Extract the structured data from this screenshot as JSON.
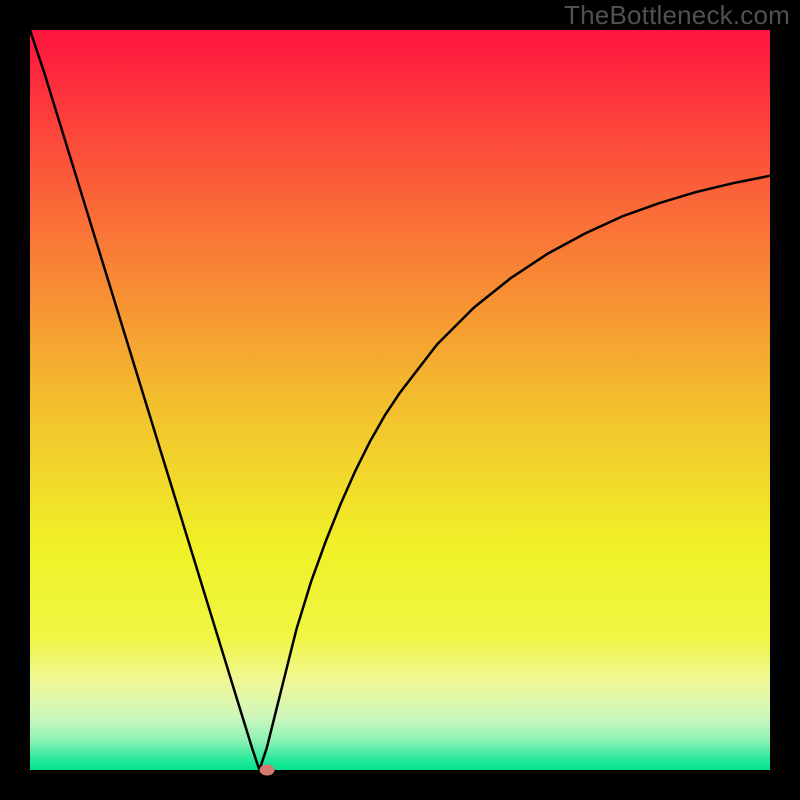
{
  "watermark": "TheBottleneck.com",
  "chart_data": {
    "type": "line",
    "title": "",
    "xlabel": "",
    "ylabel": "",
    "xlim": [
      0,
      100
    ],
    "ylim": [
      0,
      100
    ],
    "x": [
      0,
      2,
      4,
      6,
      8,
      10,
      12,
      14,
      16,
      18,
      20,
      22,
      24,
      26,
      28,
      30,
      31,
      32,
      33,
      34,
      35,
      36,
      38,
      40,
      42,
      44,
      46,
      48,
      50,
      55,
      60,
      65,
      70,
      75,
      80,
      85,
      90,
      95,
      100
    ],
    "y": [
      100,
      94,
      87.5,
      81,
      74.5,
      68,
      61.5,
      55,
      48.5,
      42,
      35.5,
      29,
      22.5,
      16,
      9.5,
      3,
      0,
      3,
      7,
      11,
      15,
      19,
      25.5,
      31,
      36,
      40.5,
      44.5,
      48,
      51,
      57.5,
      62.5,
      66.5,
      69.8,
      72.5,
      74.8,
      76.6,
      78.1,
      79.3,
      80.3
    ],
    "marker": {
      "x": 32,
      "y": 0
    },
    "gradient_stops": [
      {
        "offset": 0,
        "color": "#fe143e"
      },
      {
        "offset": 0.25,
        "color": "#fa6d38"
      },
      {
        "offset": 0.5,
        "color": "#f3bd2e"
      },
      {
        "offset": 0.7,
        "color": "#f0f128"
      },
      {
        "offset": 0.82,
        "color": "#f0f643"
      },
      {
        "offset": 0.88,
        "color": "#f1f796"
      },
      {
        "offset": 0.93,
        "color": "#ccf7bd"
      },
      {
        "offset": 0.96,
        "color": "#8cf2b5"
      },
      {
        "offset": 0.985,
        "color": "#2be89c"
      },
      {
        "offset": 1,
        "color": "#00e38c"
      }
    ]
  }
}
